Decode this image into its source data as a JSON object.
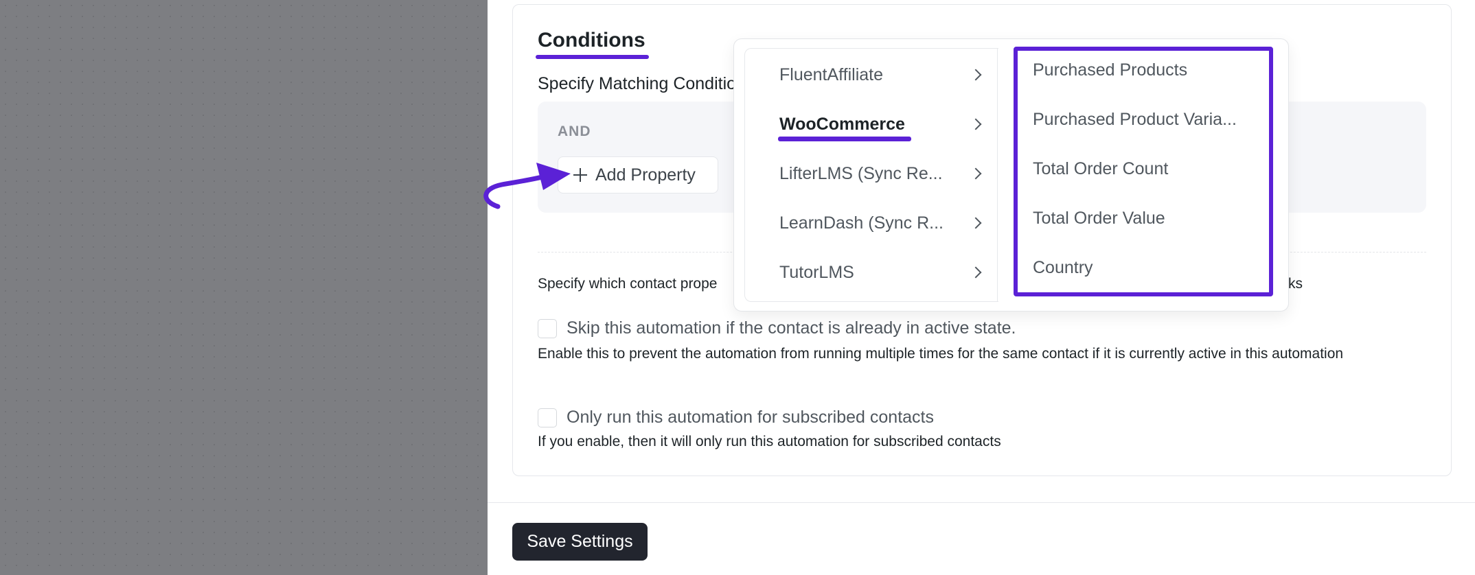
{
  "conditions": {
    "heading": "Conditions",
    "subheading": "Specify Matching Conditions",
    "and_label": "AND",
    "add_property_label": "Add Property"
  },
  "dropdown": {
    "providers": [
      {
        "label": "FluentAffiliate"
      },
      {
        "label": "WooCommerce",
        "active": true
      },
      {
        "label": "LifterLMS (Sync Re..."
      },
      {
        "label": "LearnDash (Sync R..."
      },
      {
        "label": "TutorLMS"
      }
    ],
    "options": [
      "Purchased Products",
      "Purchased Product Varia...",
      "Total Order Count",
      "Total Order Value",
      "Country"
    ]
  },
  "settings": {
    "contact_props_text": "Specify which contact prope",
    "contact_props_tail": "ks",
    "skip_active_label": "Skip this automation if the contact is already in active state.",
    "skip_active_desc": "Enable this to prevent the automation from running multiple times for the same contact if it is currently active in this automation",
    "subscribed_only_label": "Only run this automation for subscribed contacts",
    "subscribed_only_desc": "If you enable, then it will only run this automation for subscribed contacts"
  },
  "footer": {
    "save_label": "Save Settings"
  },
  "colors": {
    "accent": "#5b21d6",
    "save_button_bg": "#22252e",
    "backdrop": "#7d7e82"
  }
}
